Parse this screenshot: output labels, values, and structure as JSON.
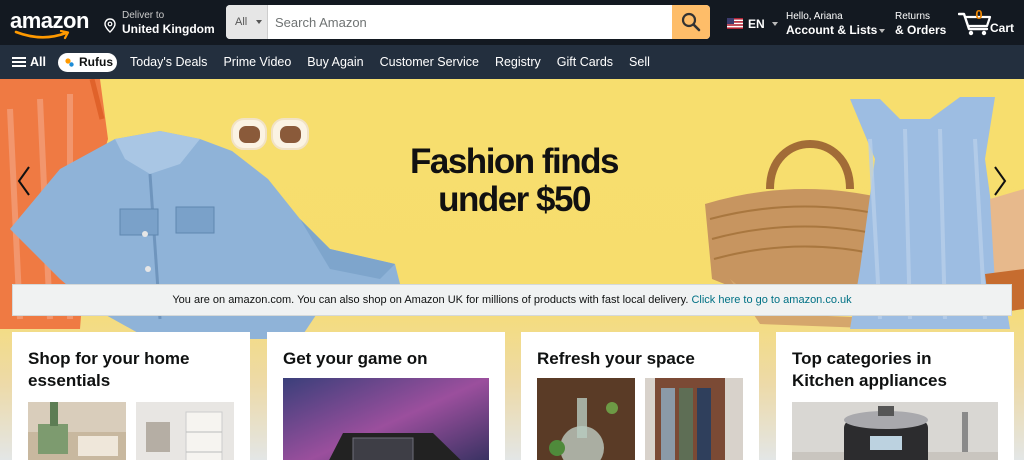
{
  "header": {
    "logo_text": "amazon",
    "deliver_label": "Deliver to",
    "deliver_location": "United Kingdom",
    "search": {
      "category": "All",
      "placeholder": "Search Amazon"
    },
    "language": "EN",
    "account_greeting": "Hello, Ariana",
    "account_label": "Account & Lists",
    "returns_label": "Returns",
    "orders_label": "& Orders",
    "cart_count": "0",
    "cart_label": "Cart"
  },
  "subnav": {
    "all_label": "All",
    "rufus_label": "Rufus",
    "links": [
      "Today's Deals",
      "Prime Video",
      "Buy Again",
      "Customer Service",
      "Registry",
      "Gift Cards",
      "Sell"
    ]
  },
  "hero": {
    "headline_line1": "Fashion finds",
    "headline_line2": "under $50"
  },
  "notice": {
    "text": "You are on amazon.com. You can also shop on Amazon UK for millions of products with fast local delivery.",
    "link": "Click here to go to amazon.co.uk"
  },
  "cards": [
    {
      "title": "Shop for your home essentials"
    },
    {
      "title": "Get your game on"
    },
    {
      "title": "Refresh your space"
    },
    {
      "title": "Top categories in Kitchen appliances"
    }
  ],
  "colors": {
    "nav_bg": "#131921",
    "subnav_bg": "#232f3e",
    "search_button": "#febd69",
    "cart_count": "#f08804",
    "hero_bg": "#f7de6e",
    "link": "#007185"
  }
}
